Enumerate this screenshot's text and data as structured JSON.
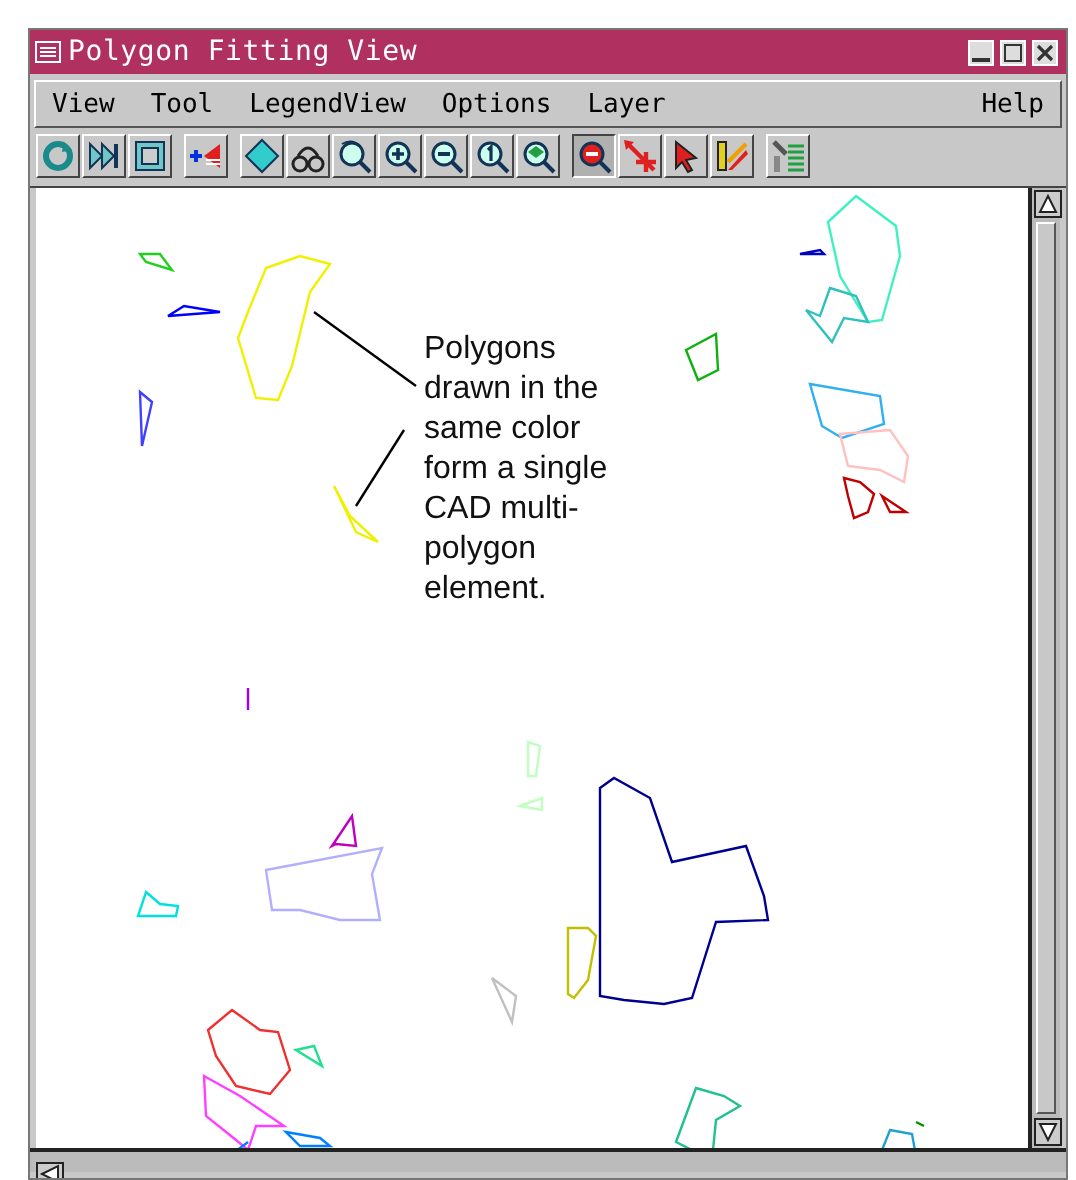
{
  "window": {
    "title": "Polygon Fitting View"
  },
  "menu": [
    "View",
    "Tool",
    "LegendView",
    "Options",
    "Layer",
    "Help"
  ],
  "toolbar_groups": [
    [
      {
        "kind": "refresh",
        "pressed": false
      },
      {
        "kind": "skip",
        "pressed": false
      },
      {
        "kind": "frame",
        "pressed": false
      }
    ],
    [
      {
        "kind": "addlayer",
        "pressed": false
      }
    ],
    [
      {
        "kind": "diamond",
        "pressed": false
      },
      {
        "kind": "binoculars",
        "pressed": false
      },
      {
        "kind": "zoomback",
        "pressed": false
      },
      {
        "kind": "zoomin",
        "pressed": false
      },
      {
        "kind": "zoomout",
        "pressed": false
      },
      {
        "kind": "zoomone",
        "pressed": false
      },
      {
        "kind": "zoommap",
        "pressed": false
      }
    ],
    [
      {
        "kind": "zoomred",
        "pressed": true
      },
      {
        "kind": "crossarrow",
        "pressed": false
      },
      {
        "kind": "pointer",
        "pressed": false
      },
      {
        "kind": "ruler",
        "pressed": false
      }
    ],
    [
      {
        "kind": "list",
        "pressed": false
      }
    ]
  ],
  "callout": "Polygons\ndrawn in the\nsame color\nform a single\nCAD multi-\npolygon\nelement."
}
